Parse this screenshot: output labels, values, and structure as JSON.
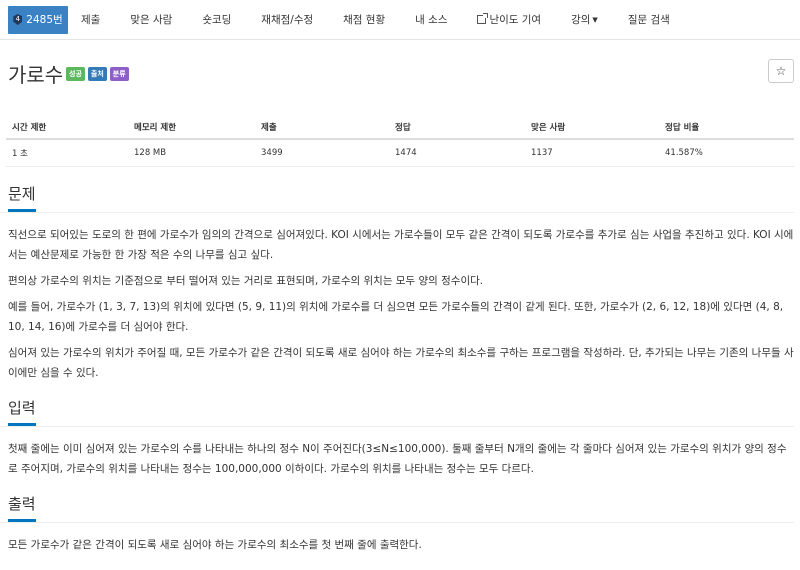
{
  "nav": {
    "problem_number": "2485번",
    "items": [
      "제출",
      "맞은 사람",
      "숏코딩",
      "재채점/수정",
      "채점 현황",
      "내 소스",
      "난이도 기여",
      "강의",
      "질문 검색"
    ]
  },
  "problem": {
    "title": "가로수",
    "labels": {
      "success": "성공",
      "source": "출처",
      "class": "분류"
    },
    "star": "☆"
  },
  "info": {
    "headers": [
      "시간 제한",
      "메모리 제한",
      "제출",
      "정답",
      "맞은 사람",
      "정답 비율"
    ],
    "values": [
      "1 초",
      "128 MB",
      "3499",
      "1474",
      "1137",
      "41.587%"
    ]
  },
  "sections": {
    "description": {
      "title": "문제",
      "paragraphs": [
        "직선으로 되어있는 도로의 한 편에 가로수가 임의의 간격으로 심어져있다. KOI 시에서는 가로수들이 모두 같은 간격이 되도록 가로수를 추가로 심는 사업을 추진하고 있다. KOI 시에서는 예산문제로 가능한 한 가장 적은 수의 나무를 심고 싶다.",
        "편의상 가로수의 위치는 기준점으로 부터 떨어져 있는 거리로 표현되며, 가로수의 위치는 모두 양의 정수이다.",
        "예를 들어, 가로수가 (1, 3, 7, 13)의 위치에 있다면 (5, 9, 11)의 위치에 가로수를 더 심으면 모든 가로수들의 간격이 같게 된다. 또한, 가로수가 (2, 6, 12, 18)에 있다면 (4, 8, 10, 14, 16)에 가로수를 더 심어야 한다.",
        "심어져 있는 가로수의 위치가 주어질 때, 모든 가로수가 같은 간격이 되도록 새로 심어야 하는 가로수의 최소수를 구하는 프로그램을 작성하라. 단, 추가되는 나무는 기존의 나무들 사이에만 심을 수 있다."
      ]
    },
    "input": {
      "title": "입력",
      "paragraphs": [
        "첫째 줄에는 이미 심어져 있는 가로수의 수를 나타내는 하나의 정수 N이 주어진다(3≤N≤100,000). 둘째 줄부터 N개의 줄에는 각 줄마다 심어져 있는 가로수의 위치가 양의 정수로 주어지며, 가로수의 위치를 나타내는 정수는 100,000,000 이하이다. 가로수의 위치를 나타내는 정수는 모두 다르다."
      ]
    },
    "output": {
      "title": "출력",
      "paragraphs": [
        "모든 가로수가 같은 간격이 되도록 새로 심어야 하는 가로수의 최소수를 첫 번째 줄에 출력한다."
      ]
    }
  }
}
